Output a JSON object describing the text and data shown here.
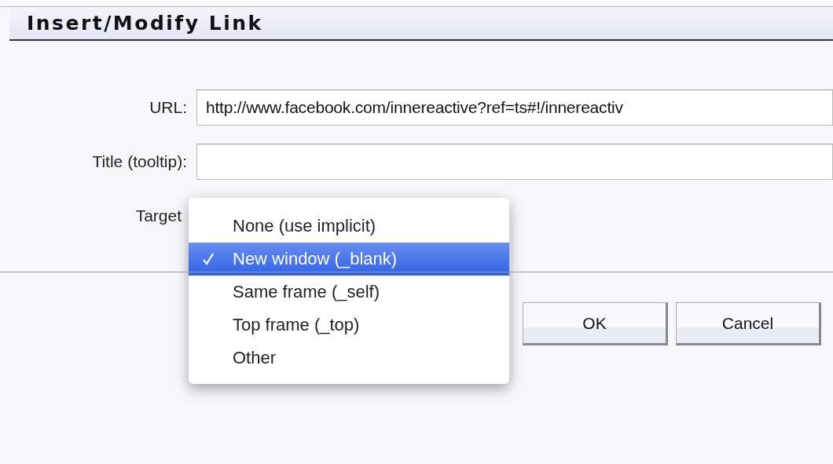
{
  "window": {
    "title": "Insert/Modify Link"
  },
  "fields": [
    {
      "label": "URL:",
      "value": "http://www.facebook.com/innereactive?ref=ts#!/innereactiv"
    },
    {
      "label": "Title (tooltip):"
    }
  ],
  "target": {
    "label": "Target",
    "options": [
      {
        "label": "None (use implicit)",
        "selected": false
      },
      {
        "label": "New window (_blank)",
        "selected": true
      },
      {
        "label": "Same frame (_self)",
        "selected": false
      },
      {
        "label": "Top frame (_top)",
        "selected": false
      },
      {
        "label": "Other",
        "selected": false
      }
    ]
  },
  "buttons": [
    "OK",
    "Cancel"
  ]
}
